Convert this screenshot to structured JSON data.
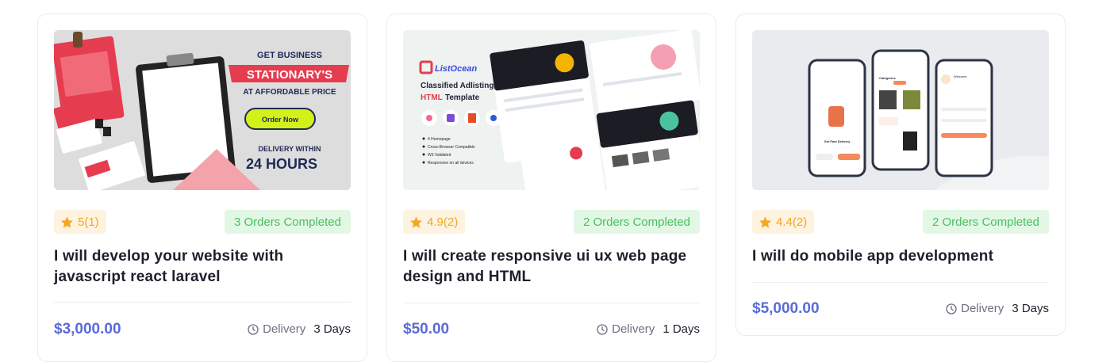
{
  "colors": {
    "price": "#5a6ad8",
    "star": "#f5a623",
    "orders_text": "#48c060",
    "brand_red": "#e63c4f"
  },
  "cards": [
    {
      "thumb": {
        "line1": "GET BUSINESS",
        "line2": "STATIONARY'S",
        "line3": "AT AFFORDABLE PRICE",
        "button": "Order Now",
        "line4": "DELIVERY WITHIN",
        "line5": "24 HOURS"
      },
      "rating": "5(1)",
      "orders": "3 Orders Completed",
      "title": "I will develop your website with javascript react laravel",
      "price": "$3,000.00",
      "delivery_label": "Delivery",
      "delivery_days": "3 Days"
    },
    {
      "thumb": {
        "brand": "ListOcean",
        "heading1": "Classified Adlisting",
        "heading2": "HTML",
        "heading3": "Template",
        "features": [
          "4 Homepage",
          "Cross-Browser Compatible",
          "W3 Validated",
          "Responsive on all devices"
        ]
      },
      "rating": "4.9(2)",
      "orders": "2 Orders Completed",
      "title": "I will create responsive ui ux web page design and HTML",
      "price": "$50.00",
      "delivery_label": "Delivery",
      "delivery_days": "1 Days"
    },
    {
      "thumb": {
        "screen1_text": "Get Fast Delivery",
        "screen2_text": "Categories",
        "screen3_text": "Welcome"
      },
      "rating": "4.4(2)",
      "orders": "2 Orders Completed",
      "title": "I will do mobile app development",
      "price": "$5,000.00",
      "delivery_label": "Delivery",
      "delivery_days": "3 Days"
    }
  ]
}
